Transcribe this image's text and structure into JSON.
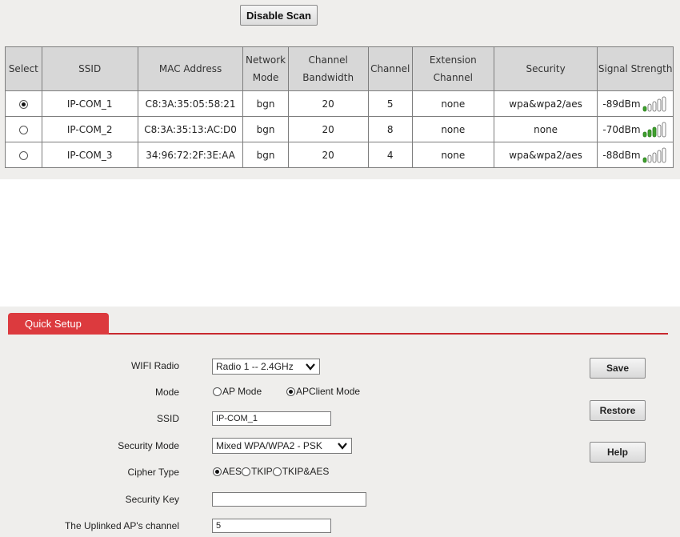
{
  "scan": {
    "disable_scan_label": "Disable Scan",
    "headers": {
      "select": "Select",
      "ssid": "SSID",
      "mac": "MAC Address",
      "network_mode": "Network Mode",
      "channel_bandwidth": "Channel Bandwidth",
      "channel": "Channel",
      "extension_channel": "Extension Channel",
      "security": "Security",
      "signal_strength": "Signal Strength"
    },
    "rows": [
      {
        "selected": true,
        "ssid": "IP-COM_1",
        "mac": "C8:3A:35:05:58:21",
        "mode": "bgn",
        "bandwidth": "20",
        "channel": "5",
        "extension": "none",
        "security": "wpa&wpa2/aes",
        "signal": "-89dBm",
        "signal_bars": 1
      },
      {
        "selected": false,
        "ssid": "IP-COM_2",
        "mac": "C8:3A:35:13:AC:D0",
        "mode": "bgn",
        "bandwidth": "20",
        "channel": "8",
        "extension": "none",
        "security": "none",
        "signal": "-70dBm",
        "signal_bars": 3
      },
      {
        "selected": false,
        "ssid": "IP-COM_3",
        "mac": "34:96:72:2F:3E:AA",
        "mode": "bgn",
        "bandwidth": "20",
        "channel": "4",
        "extension": "none",
        "security": "wpa&wpa2/aes",
        "signal": "-88dBm",
        "signal_bars": 1
      }
    ]
  },
  "setup": {
    "tab_label": "Quick Setup",
    "accent_color": "#dc3a3e",
    "wifi_radio": {
      "label": "WIFI Radio",
      "value": "Radio 1 -- 2.4GHz"
    },
    "mode": {
      "label": "Mode",
      "options": [
        "AP Mode",
        "APClient Mode"
      ],
      "selected": "APClient Mode"
    },
    "ssid": {
      "label": "SSID",
      "value": "IP-COM_1"
    },
    "security_mode": {
      "label": "Security Mode",
      "value": "Mixed WPA/WPA2 - PSK"
    },
    "cipher_type": {
      "label": "Cipher Type",
      "options": [
        "AES",
        "TKIP",
        "TKIP&AES"
      ],
      "selected": "AES"
    },
    "security_key": {
      "label": "Security Key",
      "value": ""
    },
    "uplinked_channel": {
      "label": "The Uplinked AP's channel",
      "value": "5"
    },
    "buttons": {
      "save": "Save",
      "restore": "Restore",
      "help": "Help"
    }
  }
}
